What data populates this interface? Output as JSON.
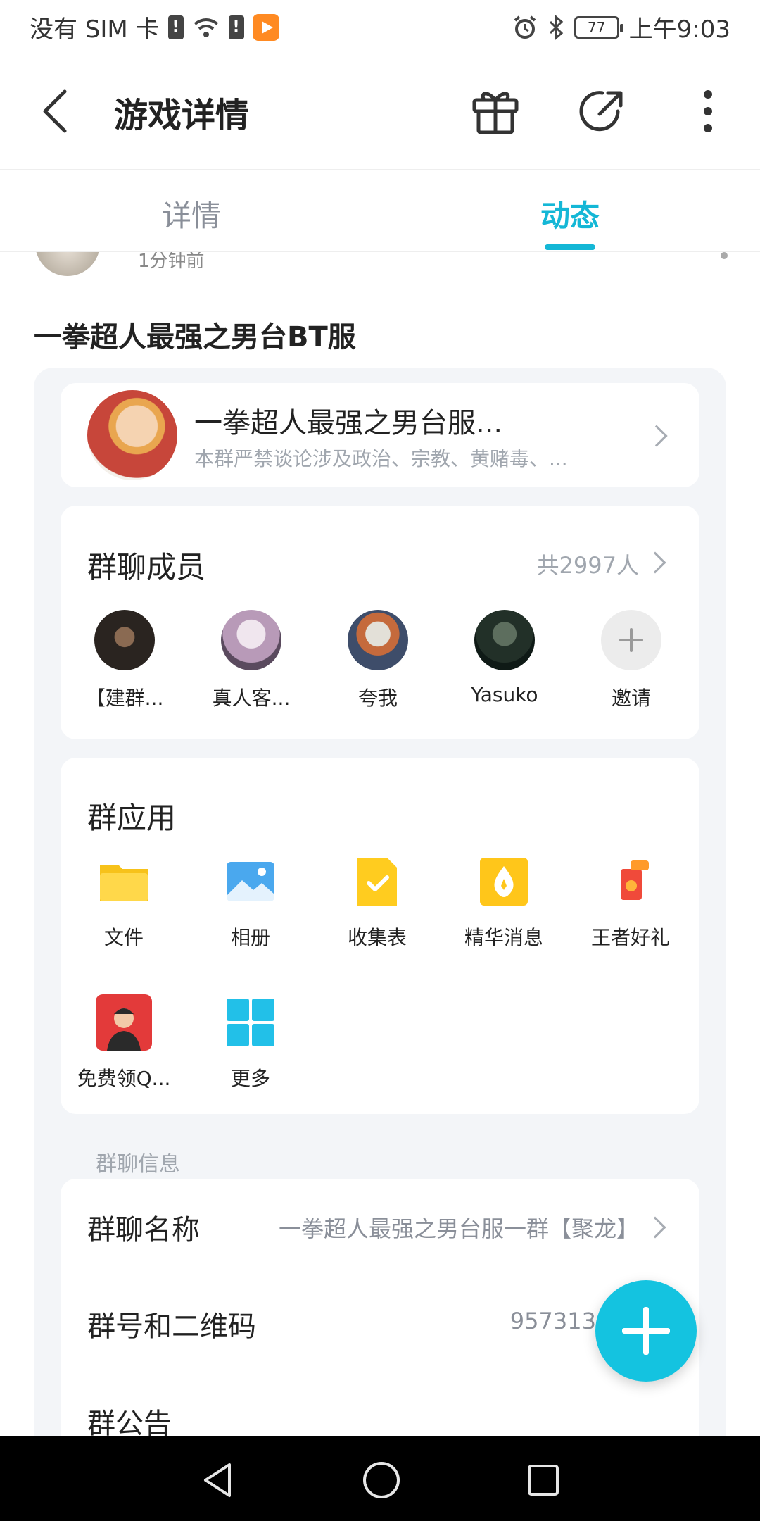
{
  "status_bar": {
    "carrier": "没有 SIM 卡",
    "time": "上午9:03",
    "battery": "77"
  },
  "header": {
    "title": "游戏详情"
  },
  "tabs": [
    {
      "label": "详情"
    },
    {
      "label": "动态"
    }
  ],
  "post": {
    "time": "1分钟前",
    "title": "一拳超人最强之男台BT服"
  },
  "group": {
    "name": "一拳超人最强之男台服...",
    "desc": "本群严禁谈论涉及政治、宗教、黄赌毒、..."
  },
  "members": {
    "title": "群聊成员",
    "count": "共2997人",
    "items": [
      {
        "name": "【建群..."
      },
      {
        "name": "真人客..."
      },
      {
        "name": "夸我"
      },
      {
        "name": "Yasuko"
      },
      {
        "name": "邀请"
      }
    ]
  },
  "apps": {
    "title": "群应用",
    "items": [
      {
        "label": "文件",
        "icon": "folder-icon"
      },
      {
        "label": "相册",
        "icon": "album-icon"
      },
      {
        "label": "收集表",
        "icon": "form-icon"
      },
      {
        "label": "精华消息",
        "icon": "essence-icon"
      },
      {
        "label": "王者好礼",
        "icon": "gift-icon"
      },
      {
        "label": "免费领Q...",
        "icon": "promo-icon"
      },
      {
        "label": "更多",
        "icon": "more-apps-icon"
      }
    ]
  },
  "info": {
    "section_label": "群聊信息",
    "rows": [
      {
        "key": "群聊名称",
        "value": "一拳超人最强之男台服一群【聚龙】"
      },
      {
        "key": "群号和二维码",
        "value": "957313492"
      },
      {
        "key": "群公告",
        "value": ""
      }
    ]
  },
  "colors": {
    "accent": "#14b7d6",
    "fab": "#14c3e0"
  }
}
